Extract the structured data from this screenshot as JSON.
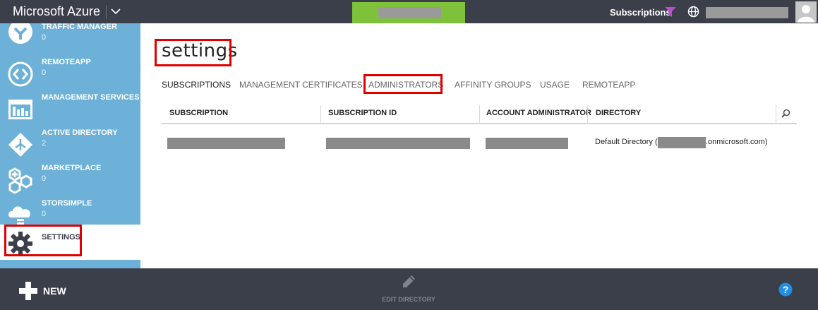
{
  "header": {
    "brand": "Microsoft Azure",
    "subscriptions_label": "Subscriptions",
    "colors": {
      "bar": "#3a3f4a",
      "accent_green": "#7dc23a",
      "filter": "#c04ad0"
    }
  },
  "sidebar": {
    "background": "#6db1d8",
    "items": [
      {
        "label": "TRAFFIC MANAGER",
        "count": "0",
        "icon": "traffic-manager-icon"
      },
      {
        "label": "REMOTEAPP",
        "count": "0",
        "icon": "remoteapp-icon"
      },
      {
        "label": "MANAGEMENT SERVICES",
        "count": "",
        "icon": "management-services-icon"
      },
      {
        "label": "ACTIVE DIRECTORY",
        "count": "2",
        "icon": "active-directory-icon"
      },
      {
        "label": "MARKETPLACE",
        "count": "0",
        "icon": "marketplace-icon"
      },
      {
        "label": "STORSIMPLE",
        "count": "0",
        "icon": "storsimple-icon"
      },
      {
        "label": "SETTINGS",
        "count": "",
        "icon": "gear-icon",
        "active": true
      }
    ]
  },
  "main": {
    "title": "settings",
    "tabs": [
      {
        "label": "SUBSCRIPTIONS",
        "active": true
      },
      {
        "label": "MANAGEMENT CERTIFICATES"
      },
      {
        "label": "ADMINISTRATORS"
      },
      {
        "label": "AFFINITY GROUPS"
      },
      {
        "label": "USAGE"
      },
      {
        "label": "REMOTEAPP"
      }
    ],
    "table": {
      "columns": [
        "SUBSCRIPTION",
        "SUBSCRIPTION ID",
        "ACCOUNT ADMINISTRATOR",
        "DIRECTORY"
      ],
      "rows": [
        {
          "directory_prefix": "Default Directory (",
          "directory_suffix": ".onmicrosoft.com)"
        }
      ]
    }
  },
  "footer": {
    "new_label": "NEW",
    "edit_directory_label": "EDIT DIRECTORY"
  },
  "annotation_color": "#e00000"
}
